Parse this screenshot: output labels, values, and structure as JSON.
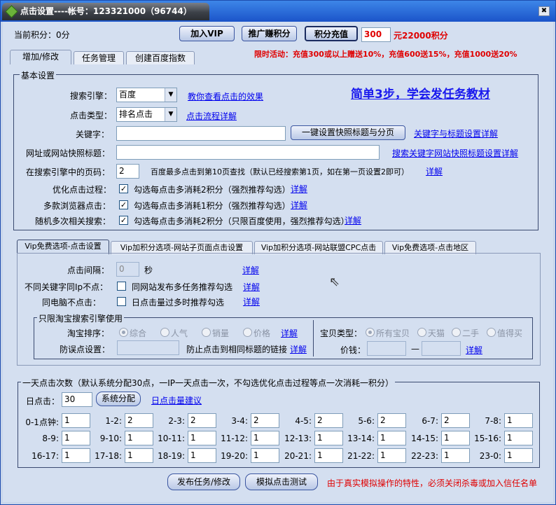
{
  "title": "点击设置----帐号：123321000（96744）",
  "top": {
    "points_label": "当前积分：0分",
    "join_vip": "加入VIP",
    "promote": "推广赚积分",
    "recharge": "积分充值",
    "recharge_value": "300",
    "recharge_note": "元22000积分",
    "promo": "限时活动：充值300或以上赠送10%，充值600送15%，充值1000送20%"
  },
  "tabs": [
    "增加/修改",
    "任务管理",
    "创建百度指数"
  ],
  "basic": {
    "legend": "基本设置",
    "engine_label": "搜索引擎：",
    "engine_value": "百度",
    "engine_link": "教你查看点击的效果",
    "type_label": "点击类型：",
    "type_value": "排名点击",
    "type_link": "点击流程详解",
    "big_link": "简单3步，学会发任务教材",
    "keyword_label": "关键字：",
    "keyword_btn": "一键设置快照标题与分页",
    "keyword_link": "关键字与标题设置详解",
    "url_label": "网址或网站快照标题：",
    "url_link": "搜索关键字网站快照标题设置详解",
    "page_label": "在搜索引擎中的页码：",
    "page_value": "2",
    "page_note": "百度最多点击到第10页查找（默认已经搜索第1页，如在第一页设置2即可）",
    "page_link": "详解",
    "opt_label": "优化点击过程：",
    "opt_text": "勾选每点击多消耗2积分（强烈推荐勾选）",
    "opt_link": "详解",
    "multi_label": "多款浏览器点击：",
    "multi_text": "勾选每点击多消耗1积分（强烈推荐勾选）",
    "multi_link": "详解",
    "rand_label": "随机多次相关搜索：",
    "rand_text": "勾选每点击多消耗2积分（只限百度使用，强烈推荐勾选）",
    "rand_link": "详解",
    "check_mark": "✓"
  },
  "vip_tabs": [
    "Vip免费选项-点击设置",
    "Vip加积分选项-网站子页面点击设置",
    "Vip加积分选项-网站联盟CPC点击",
    "Vip免费选项-点击地区"
  ],
  "vip": {
    "interval_label": "点击间隔：",
    "interval_value": "0",
    "interval_unit": "秒",
    "interval_link": "详解",
    "ip_label": "不同关键字同Ip不点：",
    "ip_text": "同网站发布多任务推荐勾选",
    "ip_link": "详解",
    "pc_label": "同电脑不点击：",
    "pc_text": "日点击量过多时推荐勾选",
    "pc_link": "详解",
    "taobao_legend": "只限淘宝搜索引擎使用",
    "sort_label": "淘宝排序：",
    "sort_opts": [
      "综合",
      "人气",
      "销量",
      "价格"
    ],
    "sort_link": "详解",
    "err_label": "防误点设置：",
    "err_text": "防止点击到相同标题的链接",
    "err_link": "详解",
    "type_label": "宝贝类型：",
    "type_opts": [
      "所有宝贝",
      "天猫",
      "二手",
      "值得买"
    ],
    "price_label": "价钱：",
    "price_dash": "—",
    "price_link": "详解"
  },
  "daily": {
    "legend": "一天点击次数（默认系统分配30点，一IP一天点击一次，不勾选优化点击过程等点一次消耗一积分）",
    "label": "日点击：",
    "value": "30",
    "btn": "系统分配",
    "link": "日点击量建议",
    "hours": [
      {
        "l": "0-1点钟:",
        "v": "1"
      },
      {
        "l": "1-2:",
        "v": "2"
      },
      {
        "l": "2-3:",
        "v": "2"
      },
      {
        "l": "3-4:",
        "v": "2"
      },
      {
        "l": "4-5:",
        "v": "2"
      },
      {
        "l": "5-6:",
        "v": "2"
      },
      {
        "l": "6-7:",
        "v": "2"
      },
      {
        "l": "7-8:",
        "v": "1"
      },
      {
        "l": "8-9:",
        "v": "1"
      },
      {
        "l": "9-10:",
        "v": "1"
      },
      {
        "l": "10-11:",
        "v": "1"
      },
      {
        "l": "11-12:",
        "v": "1"
      },
      {
        "l": "12-13:",
        "v": "1"
      },
      {
        "l": "13-14:",
        "v": "1"
      },
      {
        "l": "14-15:",
        "v": "1"
      },
      {
        "l": "15-16:",
        "v": "1"
      },
      {
        "l": "16-17:",
        "v": "1"
      },
      {
        "l": "17-18:",
        "v": "1"
      },
      {
        "l": "18-19:",
        "v": "1"
      },
      {
        "l": "19-20:",
        "v": "1"
      },
      {
        "l": "20-21:",
        "v": "1"
      },
      {
        "l": "21-22:",
        "v": "1"
      },
      {
        "l": "22-23:",
        "v": "1"
      },
      {
        "l": "23-0:",
        "v": "1"
      }
    ]
  },
  "bottom": {
    "publish": "发布任务/修改",
    "simulate": "模拟点击测试",
    "note": "由于真实模拟操作的特性，必须关闭杀毒或加入信任名单"
  },
  "colors": {
    "title_bg": "#1b54c9",
    "client_bg": "#d4dff0",
    "link": "#0000ee",
    "alert": "#e00000"
  }
}
